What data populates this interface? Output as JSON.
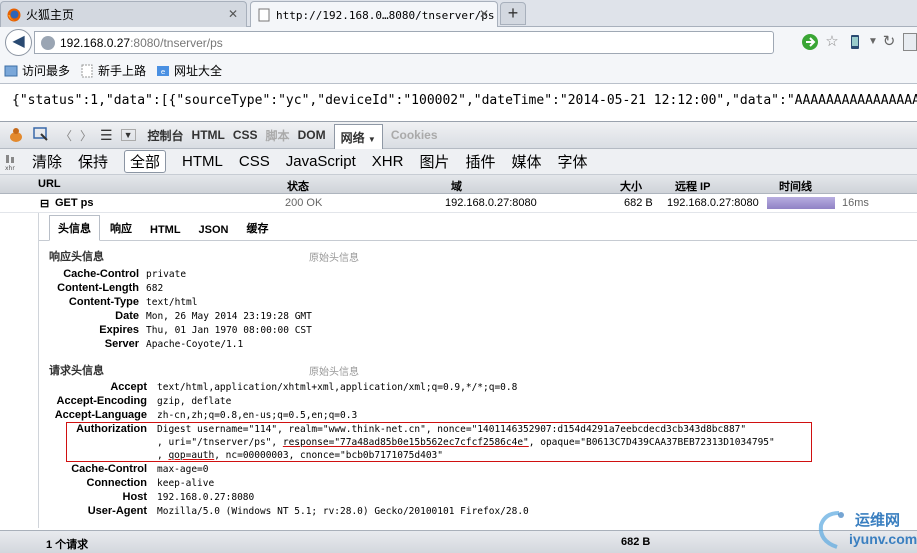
{
  "tabs": [
    {
      "label": "火狐主页",
      "active": false
    },
    {
      "label": "http://192.168.0…8080/tnserver/ps",
      "active": true
    }
  ],
  "new_tab_label": "+",
  "navbar": {
    "url_host": "192.168.0.27",
    "url_path": ":8080/tnserver/ps"
  },
  "bookmarks": [
    {
      "label": "访问最多",
      "icon": "bookmark-icon"
    },
    {
      "label": "新手上路",
      "icon": "page-icon"
    },
    {
      "label": "网址大全",
      "icon": "site-directory-icon"
    }
  ],
  "content": {
    "line1": "{\"status\":1,\"data\":[{\"sourceType\":\"yc\",\"deviceId\":\"100002\",\"dateTime\":\"2014-05-21 12:12:00\",\"data\":\"AAAAAAAAAAAAAAAAAA"
  },
  "firebug_toolbar": {
    "console": "控制台",
    "html": "HTML",
    "css": "CSS",
    "script": "脚本",
    "dom": "DOM",
    "net": "网络",
    "cookies": "Cookies"
  },
  "filters": [
    "清除",
    "保持",
    "全部",
    "HTML",
    "CSS",
    "JavaScript",
    "XHR",
    "图片",
    "插件",
    "媒体",
    "字体"
  ],
  "selected_filter": "全部",
  "net_columns": {
    "url": "URL",
    "status": "状态",
    "domain": "域",
    "size": "大小",
    "remote_ip": "远程 IP",
    "timeline": "时间线"
  },
  "net_request": {
    "url": "GET ps",
    "status": "200 OK",
    "domain": "192.168.0.27:8080",
    "size": "682 B",
    "remote_ip": "192.168.0.27:8080",
    "time": "16ms"
  },
  "detail_tabs": [
    "头信息",
    "响应",
    "HTML",
    "JSON",
    "缓存"
  ],
  "response_headers_title": "响应头信息",
  "raw_headers_link": "原始头信息",
  "response_headers": [
    {
      "name": "Cache-Control",
      "value": "private"
    },
    {
      "name": "Content-Length",
      "value": "682"
    },
    {
      "name": "Content-Type",
      "value": "text/html"
    },
    {
      "name": "Date",
      "value": "Mon, 26 May 2014 23:19:28 GMT"
    },
    {
      "name": "Expires",
      "value": "Thu, 01 Jan 1970 08:00:00 CST"
    },
    {
      "name": "Server",
      "value": "Apache-Coyote/1.1"
    }
  ],
  "request_headers_title": "请求头信息",
  "request_headers": [
    {
      "name": "Accept",
      "value": "text/html,application/xhtml+xml,application/xml;q=0.9,*/*;q=0.8"
    },
    {
      "name": "Accept-Encoding",
      "value": "gzip, deflate"
    },
    {
      "name": "Accept-Language",
      "value": "zh-cn,zh;q=0.8,en-us;q=0.5,en;q=0.3"
    }
  ],
  "authorization": {
    "name": "Authorization",
    "line1": "Digest username=\"114\", realm=\"www.think-net.cn\", nonce=\"1401146352907:d154d4291a7eebcdecd3cb343d8bc887\"",
    "line2a": ", uri=\"/tnserver/ps\", ",
    "line2b": "response=\"77a48ad85b0e15b562ec7cfcf2586c4e\"",
    "line2c": ", opaque=\"B0613C7D439CAA37BEB72313D1034795\"",
    "line3a": ", ",
    "line3b": "qop=auth",
    "line3c": ", nc=00000003, cnonce=\"bcb0b7171075d403\""
  },
  "request_headers_after": [
    {
      "name": "Cache-Control",
      "value": "max-age=0"
    },
    {
      "name": "Connection",
      "value": "keep-alive"
    },
    {
      "name": "Host",
      "value": "192.168.0.27:8080"
    },
    {
      "name": "User-Agent",
      "value": "Mozilla/5.0 (Windows NT 5.1; rv:28.0) Gecko/20100101 Firefox/28.0"
    }
  ],
  "status_bar": {
    "count": "1 个请求",
    "total_size": "682 B"
  },
  "watermark": {
    "title": "运维网",
    "url": "iyunv.com"
  },
  "colors": {
    "highlight_box": "#d01010",
    "timeline_bar": "#9082c5"
  }
}
